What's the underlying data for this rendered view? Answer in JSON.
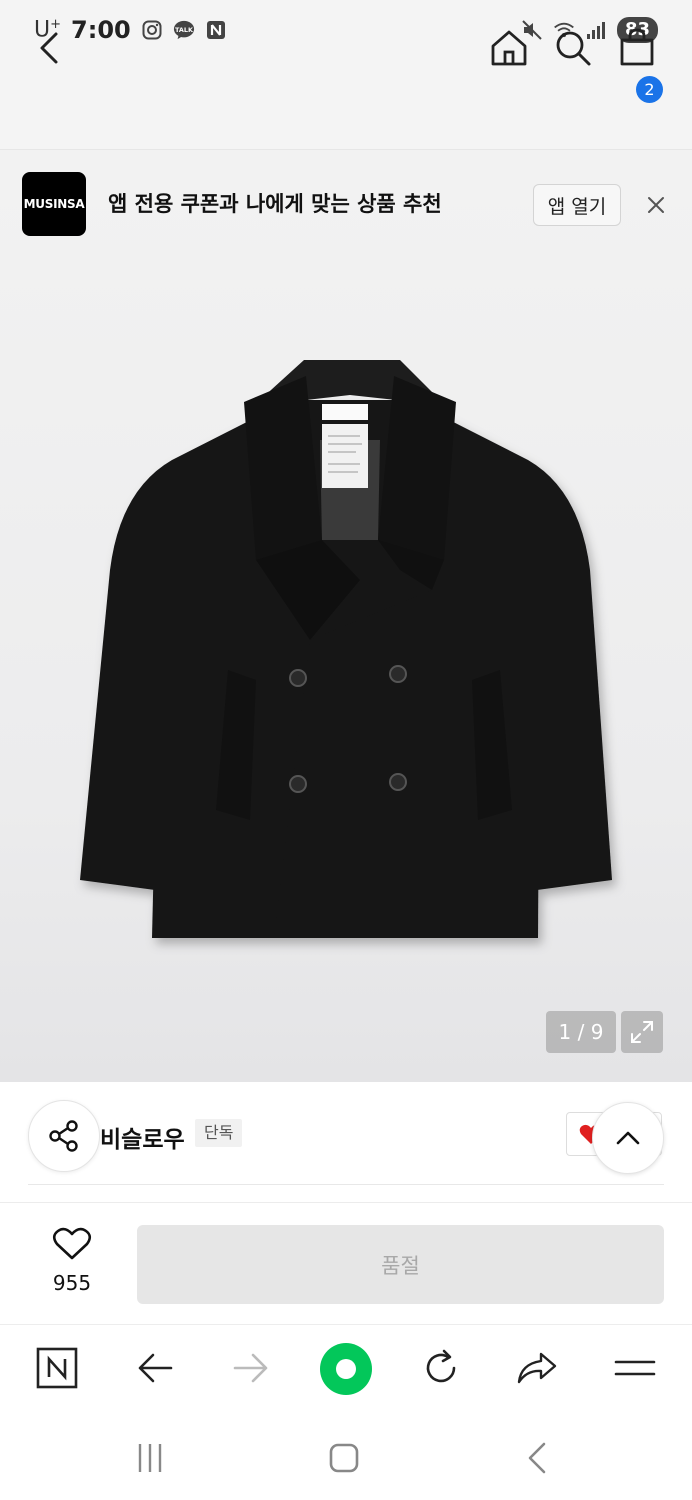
{
  "status_bar": {
    "carrier": "U",
    "carrier_sup": "+",
    "time": "7:00",
    "battery": "83",
    "notification_icons": [
      "instagram-icon",
      "kakaotalk-icon",
      "naver-icon"
    ],
    "system_icons": [
      "mute-icon",
      "wifi-icon",
      "signal-icon"
    ]
  },
  "top_nav": {
    "cart_count": "2"
  },
  "app_banner": {
    "logo_text": "MUSINSA",
    "message": "앱 전용 쿠폰과 나에게 맞는 상품 추천",
    "open_button": "앱 열기"
  },
  "gallery": {
    "counter": "1 / 9"
  },
  "product": {
    "brand": "비슬로우",
    "tag": "단독"
  },
  "purchase_bar": {
    "wish_count": "955",
    "soldout_label": "품절"
  },
  "colors": {
    "accent_blue": "#1a73e8",
    "heart_red": "#e02020",
    "naver_green": "#03c75a",
    "soldout_bg": "#e6e6e6"
  }
}
